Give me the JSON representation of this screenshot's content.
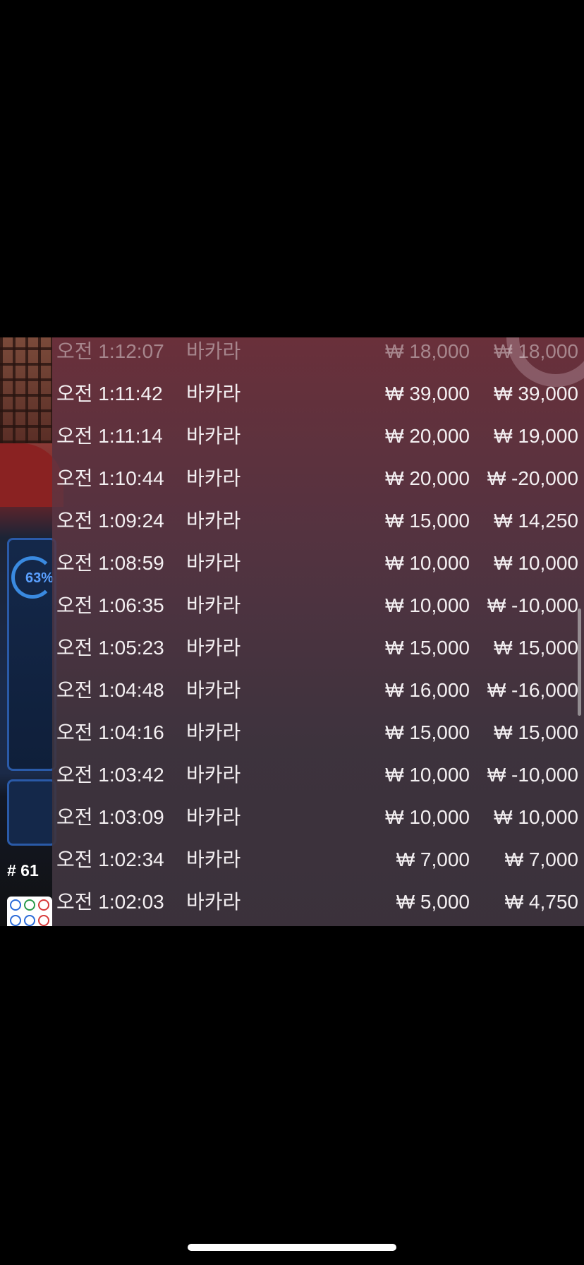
{
  "game_view": {
    "stats_percent": "63%",
    "round_label": "# 61"
  },
  "history": {
    "rows": [
      {
        "time": "오전 1:12:07",
        "game": "바카라",
        "bet": "₩ 18,000",
        "win": "₩ 18,000"
      },
      {
        "time": "오전 1:11:42",
        "game": "바카라",
        "bet": "₩ 39,000",
        "win": "₩ 39,000"
      },
      {
        "time": "오전 1:11:14",
        "game": "바카라",
        "bet": "₩ 20,000",
        "win": "₩ 19,000"
      },
      {
        "time": "오전 1:10:44",
        "game": "바카라",
        "bet": "₩ 20,000",
        "win": "₩ -20,000"
      },
      {
        "time": "오전 1:09:24",
        "game": "바카라",
        "bet": "₩ 15,000",
        "win": "₩ 14,250"
      },
      {
        "time": "오전 1:08:59",
        "game": "바카라",
        "bet": "₩ 10,000",
        "win": "₩ 10,000"
      },
      {
        "time": "오전 1:06:35",
        "game": "바카라",
        "bet": "₩ 10,000",
        "win": "₩ -10,000"
      },
      {
        "time": "오전 1:05:23",
        "game": "바카라",
        "bet": "₩ 15,000",
        "win": "₩ 15,000"
      },
      {
        "time": "오전 1:04:48",
        "game": "바카라",
        "bet": "₩ 16,000",
        "win": "₩ -16,000"
      },
      {
        "time": "오전 1:04:16",
        "game": "바카라",
        "bet": "₩ 15,000",
        "win": "₩ 15,000"
      },
      {
        "time": "오전 1:03:42",
        "game": "바카라",
        "bet": "₩ 10,000",
        "win": "₩ -10,000"
      },
      {
        "time": "오전 1:03:09",
        "game": "바카라",
        "bet": "₩ 10,000",
        "win": "₩ 10,000"
      },
      {
        "time": "오전 1:02:34",
        "game": "바카라",
        "bet": "₩ 7,000",
        "win": "₩ 7,000"
      },
      {
        "time": "오전 1:02:03",
        "game": "바카라",
        "bet": "₩ 5,000",
        "win": "₩ 4,750"
      }
    ]
  }
}
